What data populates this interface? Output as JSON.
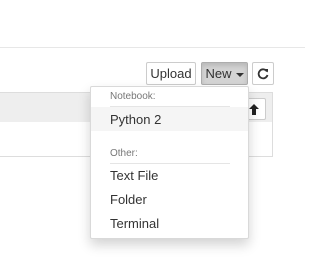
{
  "toolbar": {
    "upload_label": "Upload",
    "new_label": "New",
    "refresh_icon": "refresh-icon"
  },
  "file_list": {
    "sort_icon": "arrow-up-icon"
  },
  "new_menu": {
    "notebook_header": "Notebook:",
    "notebook_items": [
      {
        "label": "Python 2",
        "highlighted": true
      }
    ],
    "other_header": "Other:",
    "other_items": [
      {
        "label": "Text File"
      },
      {
        "label": "Folder"
      },
      {
        "label": "Terminal"
      }
    ]
  },
  "colors": {
    "active_button_bg": "#d4d4d4",
    "hover_item_bg": "#f5f5f5",
    "header_text": "#777777"
  }
}
